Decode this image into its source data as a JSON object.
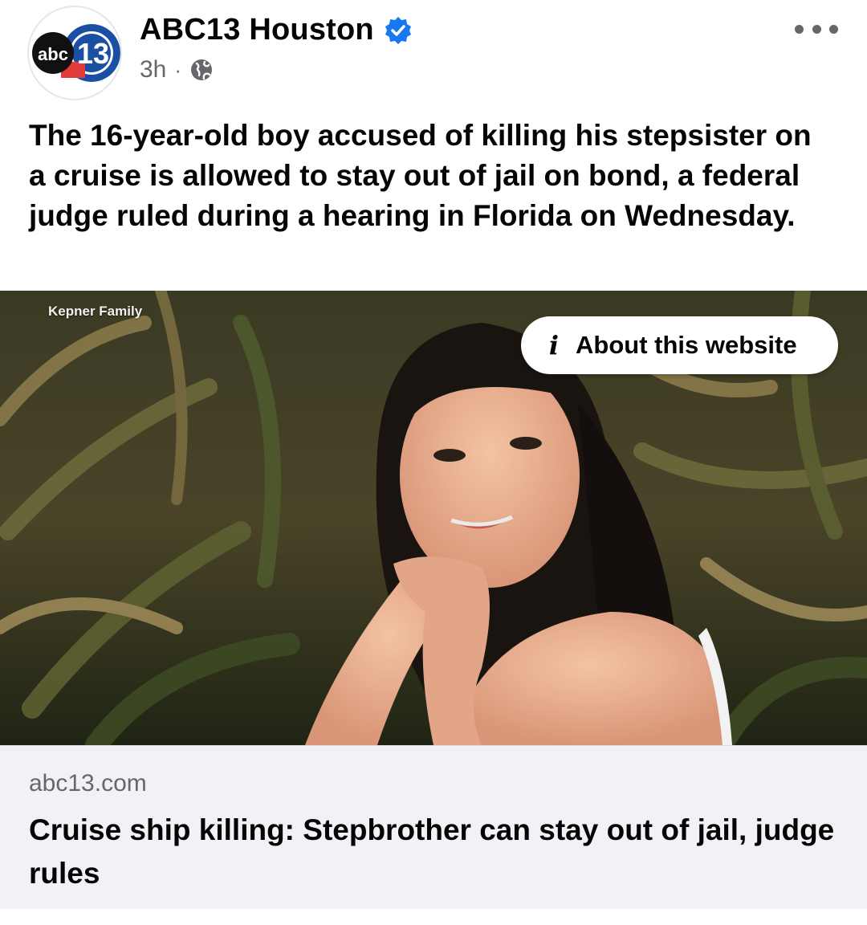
{
  "header": {
    "avatar_text_abc": "abc",
    "avatar_text_num": "13",
    "page_name": "ABC13 Houston",
    "time": "3h",
    "separator": "·",
    "verified_icon": "verified-badge-icon",
    "audience_icon": "globe-icon",
    "more_icon": "more-options-icon"
  },
  "post": {
    "caption": "The 16-year-old boy accused of killing his stepsister on a cruise is allowed to stay out of jail on bond, a federal judge ruled during a hearing in Florida on Wednesday."
  },
  "image": {
    "credit": "Kepner Family",
    "about_label": "About this website",
    "about_icon": "i"
  },
  "link": {
    "domain": "abc13.com",
    "headline": "Cruise ship killing: Stepbrother can stay out of jail, judge rules"
  },
  "colors": {
    "verified": "#1877f2",
    "abc_blue": "#1a4fa3",
    "secondary_text": "#65676b",
    "link_bg": "#f0f2f5"
  }
}
